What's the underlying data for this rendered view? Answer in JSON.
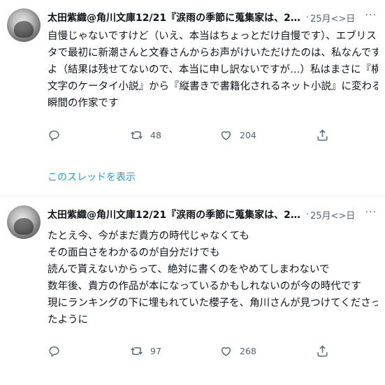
{
  "tweets": [
    {
      "author": "太田紫織@角川文庫12/21『涙雨の季節に蒐集家は、2…",
      "separator": "·",
      "date": "25月<>日",
      "more": "···",
      "lines": [
        "自慢じゃないですけど（いえ、本当はちょっとだけ自慢です）、エブリス",
        "タで最初に新潮さんと文春さんからお声がけいただけたのは、私なんです",
        "よ（結果は残せてないので、本当に申し訳ないですが…）私はまさに『横",
        "文字のケータイ小説』から『縦書きで書籍化されるネット小説』に変わる",
        "瞬間の作家です"
      ],
      "replies": "",
      "retweets": "48",
      "likes": "204"
    },
    {
      "author": "太田紫織@角川文庫12/21『涙雨の季節に蒐集家は、2…",
      "separator": "·",
      "date": "25月<>日",
      "more": "···",
      "lines": [
        "たとえ今、今がまだ貴方の時代じゃなくても",
        "その面白さをわかるのが自分だけでも",
        "読んで貰えないからって、絶対に書くのをやめてしまわないで",
        "数年後、貴方の作品が本になっているかもしれないのが今の時代です",
        "現にランキングの下に埋もれていた櫻子を、角川さんが見つけてくださっ",
        "たように"
      ],
      "replies": "",
      "retweets": "97",
      "likes": "268"
    }
  ],
  "thread_link": "このスレッドを表示",
  "icons": {
    "reply": "reply-icon",
    "retweet": "retweet-icon",
    "like": "heart-icon",
    "share": "share-icon"
  },
  "colors": {
    "link": "#1d9bf0",
    "muted": "#536471",
    "text": "#0f1419"
  }
}
